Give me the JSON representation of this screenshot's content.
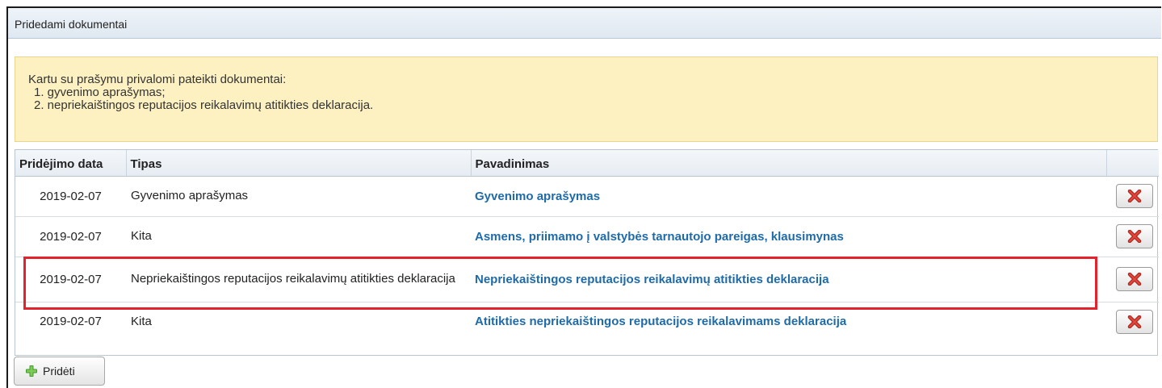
{
  "panel": {
    "title": "Pridedami dokumentai"
  },
  "notice": {
    "intro": "Kartu su prašymu privalomi pateikti dokumentai:",
    "items": [
      "1. gyvenimo aprašymas;",
      "2. nepriekaištingos reputacijos reikalavimų atitikties deklaracija."
    ],
    "background_color": "#fdf1c2"
  },
  "table": {
    "headers": [
      "Pridėjimo data",
      "Tipas",
      "Pavadinimas",
      ""
    ],
    "rows": [
      {
        "date": "2019-02-07",
        "type": "Gyvenimo aprašymas",
        "name": "Gyvenimo aprašymas"
      },
      {
        "date": "2019-02-07",
        "type": "Kita",
        "name": "Asmens, priimamo į valstybės tarnautojo pareigas, klausimynas"
      },
      {
        "date": "2019-02-07",
        "type": "Nepriekaištingos reputacijos reikalavimų atitikties deklaracija",
        "name": "Nepriekaištingos reputacijos reikalavimų atitikties deklaracija"
      },
      {
        "date": "2019-02-07",
        "type": "Kita",
        "name": "Atitikties nepriekaištingos reputacijos reikalavimams deklaracija"
      }
    ],
    "delete_icon": "red-x-icon",
    "link_color": "#1f6aa8"
  },
  "highlight": {
    "row_index": 2,
    "color": "#e3222b"
  },
  "add_button": {
    "label": "Pridėti",
    "icon": "green-plus-icon"
  }
}
